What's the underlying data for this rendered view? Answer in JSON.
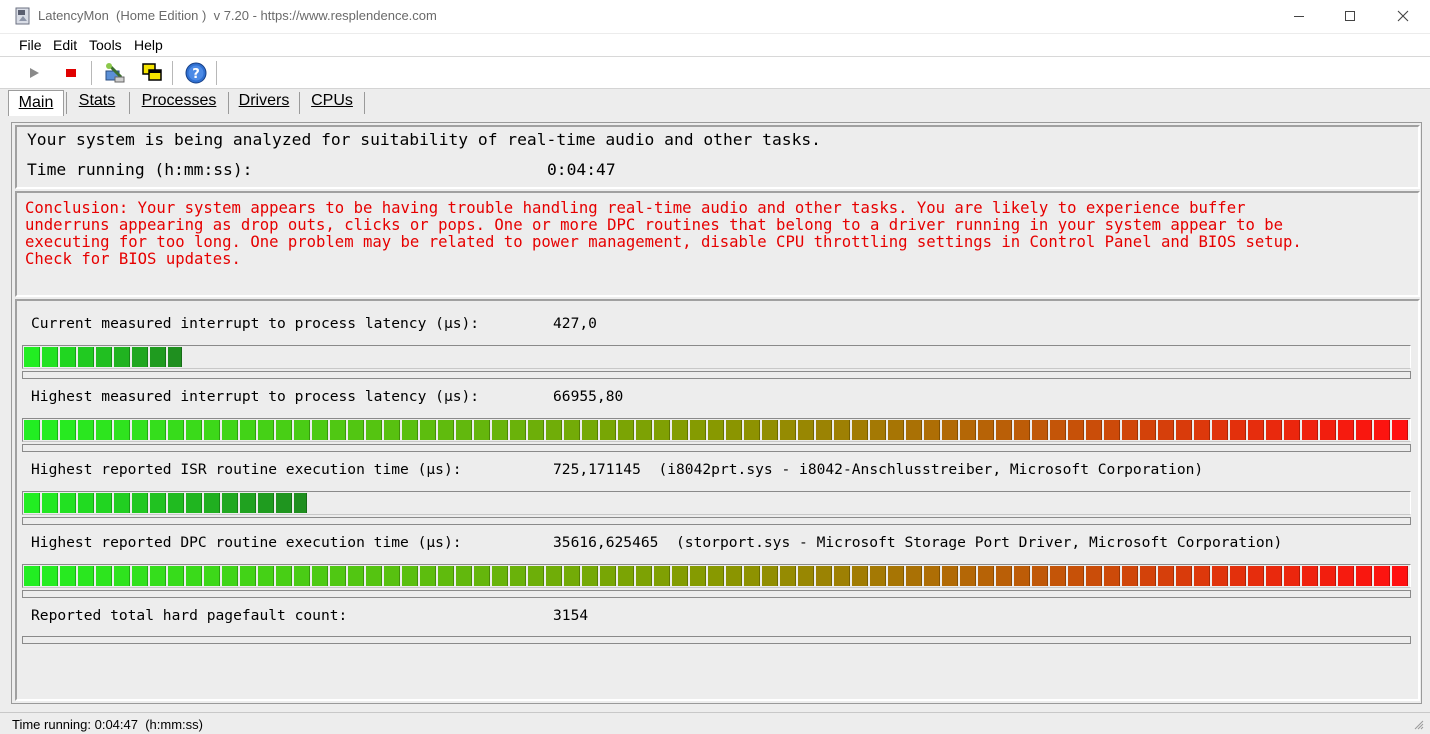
{
  "window": {
    "title": "LatencyMon  (Home Edition )  v 7.20 - https://www.resplendence.com"
  },
  "menu": {
    "items": [
      "File",
      "Edit",
      "Tools",
      "Help"
    ]
  },
  "toolbar": {
    "buttons": [
      "play-icon",
      "stop-icon",
      "tools-icon",
      "windows-icon",
      "help-icon"
    ]
  },
  "tabs": {
    "items": [
      "Main",
      "Stats",
      "Processes",
      "Drivers",
      "CPUs"
    ],
    "active": "Main"
  },
  "summary": {
    "analyzing": "Your system is being analyzed for suitability of real-time audio and other tasks.",
    "time_label": "Time running (h:mm:ss):",
    "time_value": "0:04:47"
  },
  "conclusion": {
    "text": "Conclusion: Your system appears to be having trouble handling real-time audio and other tasks. You are likely to experience buffer\nunderruns appearing as drop outs, clicks or pops. One or more DPC routines that belong to a driver running in your system appear to be\nexecuting for too long. One problem may be related to power management, disable CPU throttling settings in Control Panel and BIOS setup.\nCheck for BIOS updates.",
    "color": "#e60000"
  },
  "metrics": [
    {
      "label": "Current measured interrupt to process latency (µs):",
      "value": "427,0",
      "detail": "",
      "level": 0.115
    },
    {
      "label": "Highest measured interrupt to process latency (µs):",
      "value": "66955,80",
      "detail": "",
      "level": 1.0
    },
    {
      "label": "Highest reported ISR routine execution time (µs):",
      "value": "725,171145",
      "detail": "(i8042prt.sys - i8042-Anschlusstreiber, Microsoft Corporation)",
      "level": 0.205
    },
    {
      "label": "Highest reported DPC routine execution time (µs):",
      "value": "35616,625465",
      "detail": "(storport.sys - Microsoft Storage Port Driver, Microsoft Corporation)",
      "level": 1.0
    },
    {
      "label": "Reported total hard pagefault count:",
      "value": "3154",
      "detail": "",
      "level": 0
    }
  ],
  "colors": {
    "bar_green": "#22ee22",
    "bar_dark_green": "#1f8f1f",
    "bar_red": "#ff1010",
    "panel_bg": "#ededed"
  },
  "status": {
    "text": "Time running: 0:04:47  (h:mm:ss)"
  }
}
